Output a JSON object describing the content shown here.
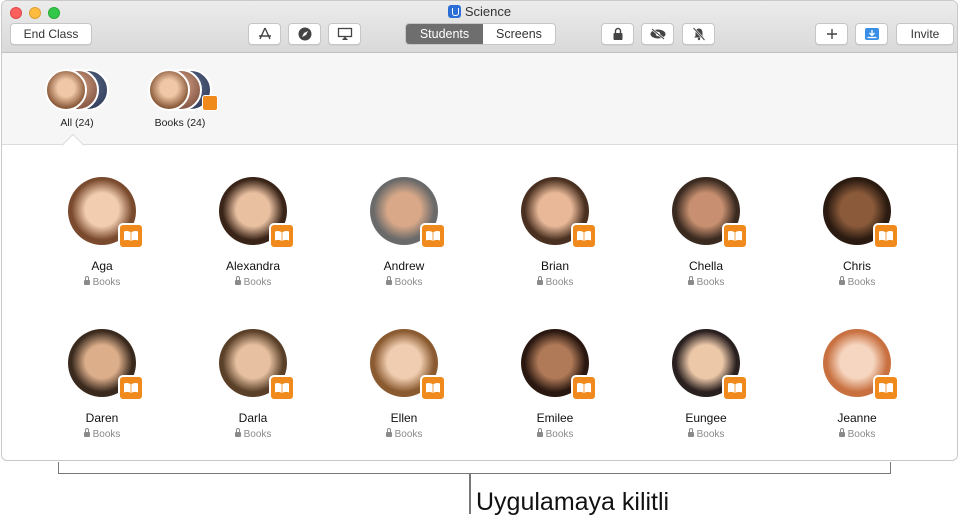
{
  "window": {
    "title": "Science"
  },
  "toolbar": {
    "end_class_label": "End Class",
    "tabs": [
      {
        "label": "Students",
        "active": true
      },
      {
        "label": "Screens",
        "active": false
      }
    ],
    "invite_label": "Invite",
    "icons": [
      "apps-icon",
      "navigate-icon",
      "airplay-icon",
      "lock-icon",
      "hide-icon",
      "mute-icon",
      "add-icon",
      "download-icon"
    ]
  },
  "groups": [
    {
      "label": "All",
      "count": "(24)"
    },
    {
      "label": "Books",
      "count": "(24)"
    }
  ],
  "students": [
    {
      "name": "Aga",
      "app": "Books"
    },
    {
      "name": "Alexandra",
      "app": "Books"
    },
    {
      "name": "Andrew",
      "app": "Books"
    },
    {
      "name": "Brian",
      "app": "Books"
    },
    {
      "name": "Chella",
      "app": "Books"
    },
    {
      "name": "Chris",
      "app": "Books"
    },
    {
      "name": "Daren",
      "app": "Books"
    },
    {
      "name": "Darla",
      "app": "Books"
    },
    {
      "name": "Ellen",
      "app": "Books"
    },
    {
      "name": "Emilee",
      "app": "Books"
    },
    {
      "name": "Eungee",
      "app": "Books"
    },
    {
      "name": "Jeanne",
      "app": "Books"
    }
  ],
  "callout": "Uygulamaya kilitli",
  "colors": {
    "badge": "#f08a1c",
    "segment_active": "#6e6e6e",
    "app_icon": "#2b6fd6"
  }
}
